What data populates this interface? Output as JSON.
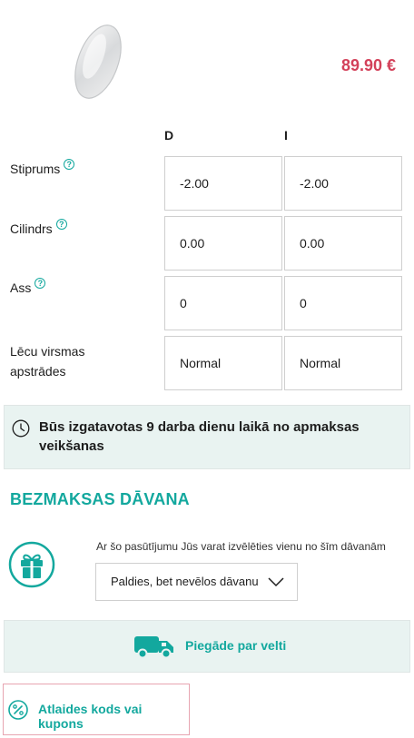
{
  "product": {
    "price": "89.90 €"
  },
  "table": {
    "columns": {
      "d": "D",
      "i": "I"
    },
    "rows": [
      {
        "label": "Stiprums",
        "d": "-2.00",
        "i": "-2.00"
      },
      {
        "label": "Cilindrs",
        "d": "0.00",
        "i": "0.00"
      },
      {
        "label": "Ass",
        "d": "0",
        "i": "0"
      },
      {
        "label_line1": "Lēcu virsmas",
        "label_line2": "apstrādes",
        "d": "Normal",
        "i": "Normal"
      }
    ],
    "help_glyph": "?"
  },
  "notice": {
    "text": "Būs izgatavotas 9 darba dienu laikā no apmaksas veikšanas"
  },
  "gift": {
    "title": "BEZMAKSAS DĀVANA",
    "description": "Ar šo pasūtījumu Jūs varat izvēlēties vienu no šīm dāvanām",
    "selected": "Paldies, bet nevēlos dāvanu"
  },
  "delivery": {
    "label": "Piegāde par velti"
  },
  "coupon": {
    "label": "Atlaides kods vai kupons"
  },
  "colors": {
    "accent": "#13a89e",
    "price": "#d3415a",
    "panel": "#e9f3f1",
    "highlight_border": "#e7a5b1"
  },
  "icons": [
    "lens-image",
    "help-icon",
    "clock-icon",
    "gift-icon",
    "chevron-down-icon",
    "truck-icon",
    "percent-icon"
  ]
}
